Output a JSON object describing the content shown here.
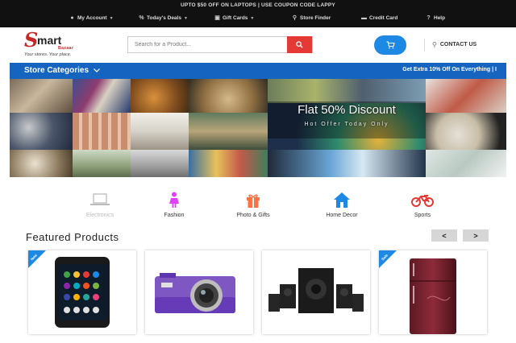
{
  "topbar": {
    "promo": "UPTO $50 OFF ON LAPTOPS | USE COUPON CODE LAPPY",
    "nav": [
      {
        "label": "My Account",
        "icon": "user-icon",
        "caret": true
      },
      {
        "label": "Today's Deals",
        "icon": "percent-icon",
        "caret": true
      },
      {
        "label": "Gift Cards",
        "icon": "gift-icon",
        "caret": true
      },
      {
        "label": "Store Finder",
        "icon": "map-pin-icon",
        "caret": false
      },
      {
        "label": "Credit Card",
        "icon": "credit-card-icon",
        "caret": false
      },
      {
        "label": "Help",
        "icon": "help-icon",
        "caret": false
      }
    ]
  },
  "header": {
    "logo": {
      "letter": "S",
      "word": "mart",
      "sub": "Bazaar",
      "tagline": "Your stores. Your place."
    },
    "search_placeholder": "Search for a Product...",
    "contact_label": "CONTACT US"
  },
  "category_bar": {
    "store_categories": "Store Categories",
    "offer": "Get Extra 10% Off On Everything | I"
  },
  "banner": {
    "title": "Flat 50% Discount",
    "subtitle": "Hot Offer Today Only"
  },
  "categories": [
    {
      "label": "Electronics",
      "icon": "laptop-icon",
      "color": "#9e9e9e",
      "active": false
    },
    {
      "label": "Fashion",
      "icon": "woman-icon",
      "color": "#e040fb",
      "active": true
    },
    {
      "label": "Photo & Gifts",
      "icon": "gift-box-icon",
      "color": "#ff7043",
      "active": true
    },
    {
      "label": "Home Decor",
      "icon": "house-icon",
      "color": "#1e88e5",
      "active": true
    },
    {
      "label": "Sports",
      "icon": "motorbike-icon",
      "color": "#e53935",
      "active": true
    }
  ],
  "featured": {
    "title": "Featured Products",
    "prev": "<",
    "next": ">",
    "products": [
      {
        "name": "smartphone",
        "badge": "New"
      },
      {
        "name": "digital camera",
        "badge": ""
      },
      {
        "name": "speaker system",
        "badge": ""
      },
      {
        "name": "refrigerator",
        "badge": "Sale"
      }
    ]
  },
  "colors": {
    "topbar": "#111111",
    "accent_red": "#e53935",
    "accent_blue": "#1e88e5",
    "category_bar": "#1565c0"
  }
}
